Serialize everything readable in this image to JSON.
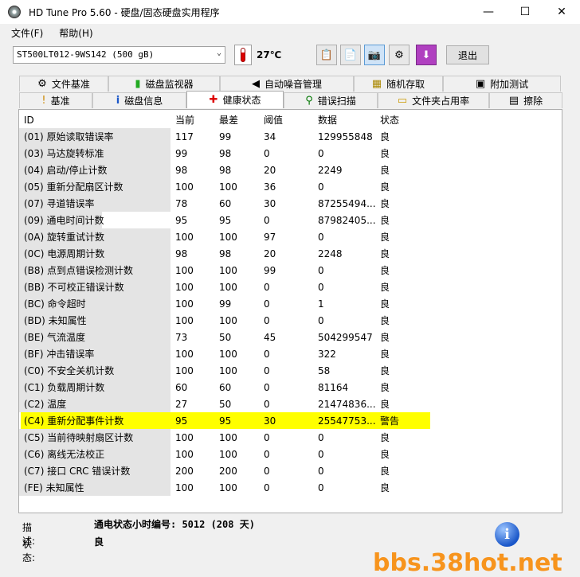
{
  "window": {
    "title": "HD Tune Pro 5.60 - 硬盘/固态硬盘实用程序",
    "minimize": "—",
    "maximize": "☐",
    "close": "✕"
  },
  "menu": [
    "文件(F)",
    "帮助(H)"
  ],
  "toolbar": {
    "drive": "ST500LT012-9WS142 (500 gB)",
    "temperature": "27℃",
    "exit_label": "退出",
    "icons": [
      "copy-text-icon",
      "copy-info-icon",
      "screenshot-icon",
      "options-icon",
      "save-down-icon"
    ]
  },
  "tabs_row1": [
    {
      "label": "文件基准",
      "icon": "file-benchmark-icon",
      "glyph": "⚙"
    },
    {
      "label": "磁盘监视器",
      "icon": "disk-monitor-icon",
      "glyph": "▮"
    },
    {
      "label": "自动噪音管理",
      "icon": "speaker-icon",
      "glyph": "◀"
    },
    {
      "label": "随机存取",
      "icon": "random-access-icon",
      "glyph": "▦"
    },
    {
      "label": "附加测试",
      "icon": "extra-tests-icon",
      "glyph": "▣"
    }
  ],
  "tabs_row2": [
    {
      "label": "基准",
      "icon": "benchmark-icon",
      "glyph": "!"
    },
    {
      "label": "磁盘信息",
      "icon": "info-icon",
      "glyph": "i"
    },
    {
      "label": "健康状态",
      "icon": "health-cross-icon",
      "glyph": "✚"
    },
    {
      "label": "错误扫描",
      "icon": "magnifier-icon",
      "glyph": "⚲"
    },
    {
      "label": "文件夹占用率",
      "icon": "folder-icon",
      "glyph": "▭"
    },
    {
      "label": "擦除",
      "icon": "eraser-icon",
      "glyph": "▤"
    }
  ],
  "table": {
    "headers": [
      "ID",
      "当前",
      "最差",
      "阈值",
      "数据",
      "状态"
    ],
    "rows": [
      [
        "(01) 原始读取错误率",
        "117",
        "99",
        "34",
        "129955848",
        "良"
      ],
      [
        "(03) 马达旋转标准",
        "99",
        "98",
        "0",
        "0",
        "良"
      ],
      [
        "(04) 启动/停止计数",
        "98",
        "98",
        "20",
        "2249",
        "良"
      ],
      [
        "(05) 重新分配扇区计数",
        "100",
        "100",
        "36",
        "0",
        "良"
      ],
      [
        "(07) 寻道错误率",
        "78",
        "60",
        "30",
        "87255494...",
        "良"
      ],
      [
        "(09) 通电时间计数",
        "95",
        "95",
        "0",
        "87982405...",
        "良"
      ],
      [
        "(0A) 旋转重试计数",
        "100",
        "100",
        "97",
        "0",
        "良"
      ],
      [
        "(0C) 电源周期计数",
        "98",
        "98",
        "20",
        "2248",
        "良"
      ],
      [
        "(B8) 点到点错误检测计数",
        "100",
        "100",
        "99",
        "0",
        "良"
      ],
      [
        "(BB) 不可校正错误计数",
        "100",
        "100",
        "0",
        "0",
        "良"
      ],
      [
        "(BC) 命令超时",
        "100",
        "99",
        "0",
        "1",
        "良"
      ],
      [
        "(BD) 未知属性",
        "100",
        "100",
        "0",
        "0",
        "良"
      ],
      [
        "(BE) 气流温度",
        "73",
        "50",
        "45",
        "504299547",
        "良"
      ],
      [
        "(BF) 冲击错误率",
        "100",
        "100",
        "0",
        "322",
        "良"
      ],
      [
        "(C0) 不安全关机计数",
        "100",
        "100",
        "0",
        "58",
        "良"
      ],
      [
        "(C1) 负载周期计数",
        "60",
        "60",
        "0",
        "81164",
        "良"
      ],
      [
        "(C2) 温度",
        "27",
        "50",
        "0",
        "21474836...",
        "良"
      ],
      [
        "(C4) 重新分配事件计数",
        "95",
        "95",
        "30",
        "25547753...",
        "警告"
      ],
      [
        "(C5) 当前待映射扇区计数",
        "100",
        "100",
        "0",
        "0",
        "良"
      ],
      [
        "(C6) 离线无法校正",
        "100",
        "100",
        "0",
        "0",
        "良"
      ],
      [
        "(C7) 接口 CRC 错误计数",
        "200",
        "200",
        "0",
        "0",
        "良"
      ],
      [
        "(FE) 未知属性",
        "100",
        "100",
        "0",
        "0",
        "良"
      ]
    ],
    "highlight_row": 17,
    "highlight_color": "#ffff00"
  },
  "footer": {
    "desc_label": "描述:",
    "desc_value": "通电状态小时编号: 5012 (208 天)",
    "status_label": "状态:",
    "status_value": "良"
  },
  "watermark": "bbs.38hot.net"
}
